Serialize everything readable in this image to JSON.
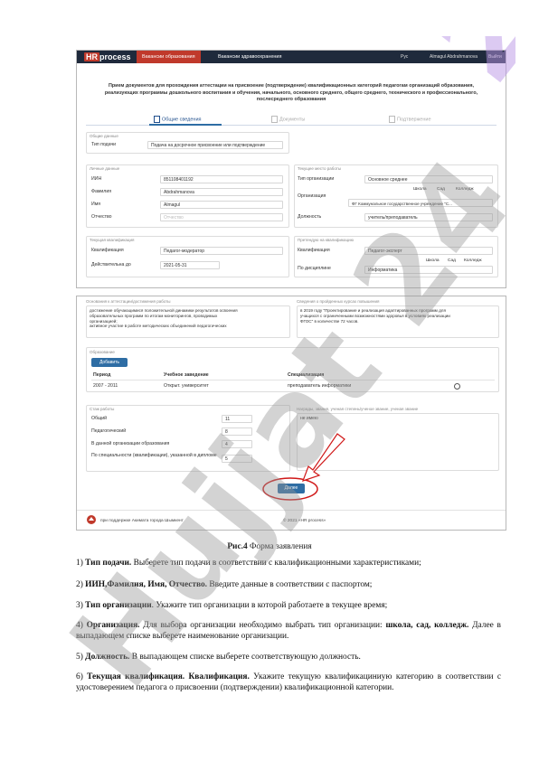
{
  "screenshot1": {
    "logo_hr": "HR",
    "logo_process": "process",
    "nav_tabs": [
      "Вакансии образования",
      "Вакансии здравоохранения"
    ],
    "lang": "Рус",
    "user": "Almagul Abdrahmanova",
    "logout": "Выйти",
    "heading_line1": "Прием документов для прохождения аттестации на присвоение (подтверждение) квалификационных категорий педагогам организаций образования,",
    "heading_line2": "реализующих программы дошкольного воспитания и обучения, начального, основного среднего, общего среднего, технического и профессионального,",
    "heading_line3": "послесреднего образования",
    "steps": [
      "Общие сведения",
      "Документы",
      "Подтвержение"
    ],
    "general_box": "Общие данные",
    "type_label": "Тип подачи",
    "type_value": "Подача на досрочное присвоение или подтверждение",
    "personal_box": "Личные данные",
    "iin_label": "ИИН",
    "iin_value": "851108401192",
    "surname_label": "Фамилия",
    "surname_value": "Abdrahmanova",
    "name_label": "Имя",
    "name_value": "Almagul",
    "patronymic_label": "Отчество",
    "patronymic_placeholder": "Отчество",
    "work_box": "Текущее место работы",
    "orgtype_label": "Тип организации",
    "orgtype_value": "Основное среднее",
    "org_chips": [
      "Школа",
      "Сад",
      "Колледж"
    ],
    "org_label": "Организация",
    "org_value": "ФГ Коммунальное государственное учреждение \"С...",
    "position_label": "Должность",
    "position_value": "учитель/преподаватель",
    "cat_box": "Текущая квалификация",
    "qual_label": "Квалификация",
    "qual_value": "Педагог-модератор",
    "valid_label": "Действительна до",
    "valid_value": "2021-05-31",
    "applying_box": "Претендую на квалификацию",
    "qual2_label": "Квалификация",
    "qual2_value": "Педагог-эксперт",
    "disc_label": "По дисциплине",
    "disc_chips": [
      "Школа",
      "Сад",
      "Колледж"
    ],
    "disc_value": "Информатика"
  },
  "screenshot2": {
    "achievements_label": "Основания к аттестации/достижения работы",
    "achievements_text": [
      "достижение обучающимися положительной динамики результатов освоения",
      "образовательных программ по итогам мониторингов, проводимых",
      "организацией;",
      "активное участие в работе методических объединений педагогических"
    ],
    "courses_label": "Сведения о пройденных курсах повышения",
    "courses_text": [
      "в 2019 году \"Проектирование и реализация адаптированных программ для",
      "учащихся с ограниченными возможностями здоровья в условиях реализации",
      "ФГОС\" в количестве 72 часов."
    ],
    "education_box": "Образование",
    "add_button": "Добавить",
    "edu_headers": [
      "Период",
      "Учебное заведение",
      "Специализация"
    ],
    "edu_row": [
      "2007 - 2011",
      "Открыт. университет",
      "преподаватель информатики"
    ],
    "experience_box": "Стаж работы",
    "exp_rows": [
      {
        "label": "Общий",
        "value": "11"
      },
      {
        "label": "Педагогический",
        "value": "8"
      },
      {
        "label": "В данной организации образования",
        "value": "4"
      },
      {
        "label": "По специальности (квалификации), указанной в дипломе",
        "value": "5"
      }
    ],
    "awards_label": "Награды, звания, ученая степень/ученое звание, ученая звание",
    "awards_value": "не имею",
    "next_button": "Далее",
    "footer_support": "при поддержке Акимата города Шымкент",
    "footer_copy": "© 2021 «HR process»"
  },
  "caption_bold": "Рис.4",
  "caption_text": " Форма заявления",
  "items": [
    {
      "num": "1)",
      "bold": "Тип подачи.",
      "text": " Выберете тип подачи в соответствии с квалификационными характеристиками;"
    },
    {
      "num": "2)",
      "bold": "ИИН,Фамилия, Имя, Отчество.",
      "text": " Введите данные в соответствии с паспортом;"
    },
    {
      "num": "3)",
      "bold": "Тип организации",
      "text": ". Укажите тип организации в которой работаете в текущее время;"
    },
    {
      "num": "4)",
      "bold": "Организация.",
      "text": " Для выбора организации необходимо выбрать тип организации: ",
      "bold2": "школа, сад, колледж.",
      "text2": " Далее в выпадающем списке выберете наименование организации."
    },
    {
      "num": "5)",
      "bold": "Должность.",
      "text": " В выпадающем списке выберете соответствующую должность."
    },
    {
      "num": "6)",
      "bold": "Текущая квалификация. Квалификация.",
      "text": " Укажите текущую квалификациниую категорию в соответствии с удостоверением педагога о присвоении (подтверждении) квалификационной категории."
    }
  ],
  "watermark": "Hujjat 24"
}
